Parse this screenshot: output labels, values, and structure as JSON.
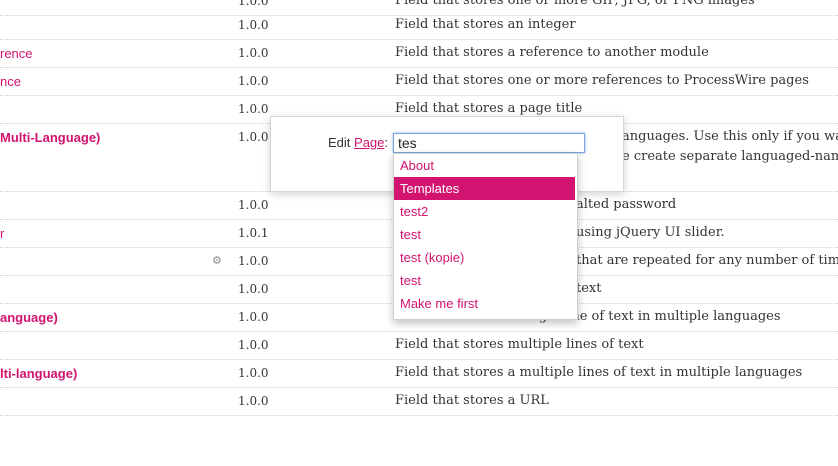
{
  "rows": [
    {
      "name": "",
      "version": "1.0.0",
      "description": "Field that stores one or more GIF, JPG, or PNG images"
    },
    {
      "name": "rence",
      "version": "1.0.0",
      "description": "Field that stores an integer"
    },
    {
      "name": "rence",
      "version": "1.0.0",
      "description": "Field that stores a reference to another module"
    },
    {
      "name": "nce",
      "version": "1.0.0",
      "description": "Field that stores one or more references to ProcessWire pages"
    },
    {
      "name": "",
      "version": "1.0.0",
      "description": "Field that stores a page title"
    },
    {
      "name": "Multi-Language)",
      "version": "1.0.0",
      "description": "anguages. Use this only if you want ti",
      "description2": "e create separate languaged-named tit"
    },
    {
      "name": "",
      "version": "1.0.0",
      "description": "alted password"
    },
    {
      "name": "r",
      "version": "1.0.1",
      "description": "using jQuery UI slider."
    },
    {
      "name": "",
      "version": "1.0.0",
      "description": "that are repeated for any number of times."
    },
    {
      "name": "",
      "version": "1.0.0",
      "description": "text"
    },
    {
      "name": "anguage)",
      "version": "1.0.0",
      "description": "Field that stores a single line of text in multiple languages"
    },
    {
      "name": "",
      "version": "1.0.0",
      "description": "Field that stores multiple lines of text"
    },
    {
      "name": "lti-language)",
      "version": "1.0.0",
      "description": "Field that stores a multiple lines of text in multiple languages"
    },
    {
      "name": "",
      "version": "1.0.0",
      "description": "Field that stores a URL"
    }
  ],
  "modal": {
    "label": "Edit",
    "link": "Page",
    "colon": ":",
    "search_value": "tes"
  },
  "dropdown": {
    "options": [
      "About",
      "Templates",
      "test2",
      "test",
      "test (kopie)",
      "test",
      "Make me first"
    ],
    "active_index": 1
  },
  "colors": {
    "accent": "#d2136f",
    "focus": "#7aa6d8"
  },
  "icons": {
    "repeater_row": "gear-icon"
  }
}
